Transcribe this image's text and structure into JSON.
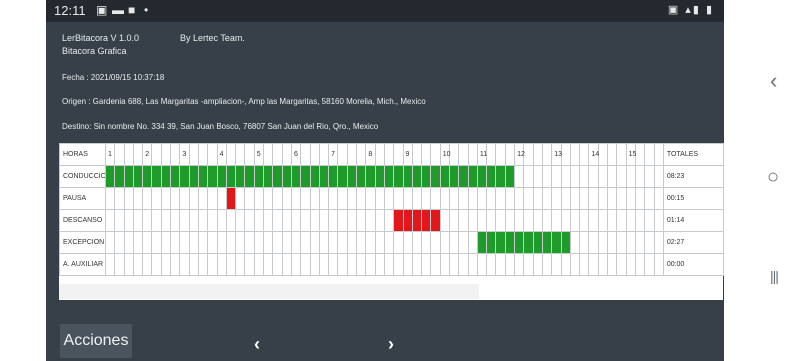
{
  "status_bar": {
    "time": "12:11"
  },
  "app": {
    "title": "LerBitacora   V 1.0.0",
    "credit": "By Lertec Team.",
    "subtitle": "Bitacora Grafica",
    "fecha": "Fecha : 2021/09/15 10:37:18",
    "origen": "Origen : Gardenia 688, Las Margaritas -ampliacion-, Amp las Margaritas, 58160 Morelia, Mich., Mexico",
    "destino": "Destino: Sin nombre No. 334 39, San Juan Bosco, 76807 San Juan del Rio, Qro., Mexico"
  },
  "grid": {
    "header_label": "HORAS",
    "totals_header": "TOTALES",
    "hour_labels": [
      "1",
      "2",
      "3",
      "4",
      "5",
      "6",
      "7",
      "8",
      "9",
      "10",
      "11",
      "12",
      "13",
      "14",
      "15"
    ],
    "rows": [
      {
        "label": "CONDUCCION",
        "total": "08:23",
        "color": "#1f9b2b",
        "filled_quarters": [
          0,
          1,
          2,
          3,
          4,
          5,
          6,
          7,
          8,
          9,
          10,
          11,
          12,
          13,
          14,
          15,
          16,
          17,
          18,
          19,
          20,
          21,
          22,
          23,
          24,
          25,
          26,
          27,
          28,
          29,
          30,
          31,
          32,
          33,
          34,
          35,
          36,
          37,
          38,
          39,
          40,
          41,
          42,
          43
        ]
      },
      {
        "label": "PAUSA",
        "total": "00:15",
        "color": "#e3161b",
        "filled_quarters": [
          13
        ]
      },
      {
        "label": "DESCANSO",
        "total": "01:14",
        "color": "#e3161b",
        "filled_quarters": [
          31,
          32,
          33,
          34,
          35
        ]
      },
      {
        "label": "EXCEPCION",
        "total": "02:27",
        "color": "#1f9b2b",
        "filled_quarters": [
          40,
          41,
          42,
          43,
          44,
          45,
          46,
          47,
          48,
          49
        ]
      },
      {
        "label": "A. AUXILIAR",
        "total": "00:00",
        "color": "#1f9b2b",
        "filled_quarters": []
      }
    ]
  },
  "footer": {
    "acciones_label": "Acciones",
    "prev": "‹",
    "next": "›"
  },
  "side_nav": {
    "back": "‹",
    "home": "○",
    "recents": "|||"
  }
}
